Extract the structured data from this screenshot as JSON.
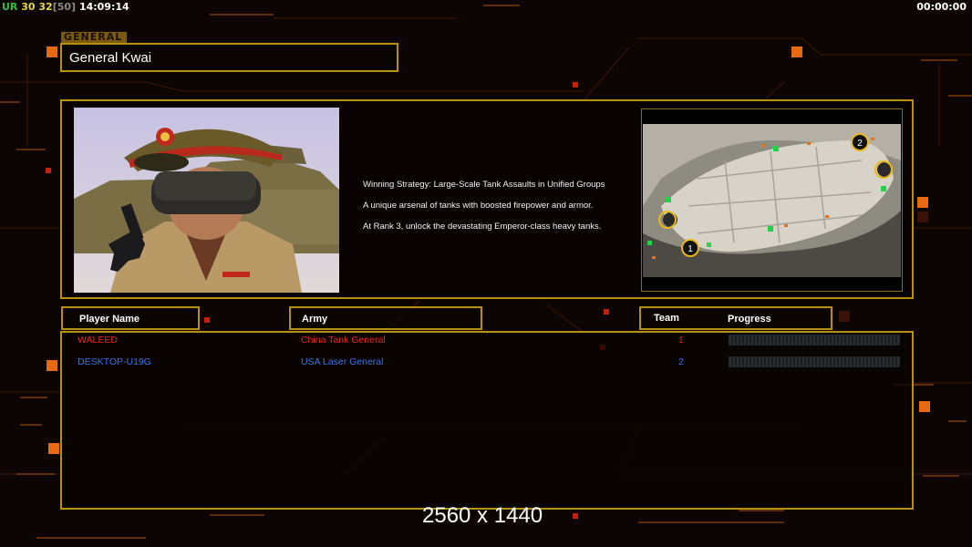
{
  "hud": {
    "ur_label": "UR",
    "ur_val1": "30",
    "ur_val2": "32",
    "ur_bracket": "[50]",
    "clock": "14:09:14",
    "timer": "00:00:00"
  },
  "section_label": "GENERAL",
  "general_name": "General Kwai",
  "strategy_lines": [
    "Winning Strategy: Large-Scale Tank Assaults in Unified Groups",
    "A unique arsenal of tanks with boosted firepower and armor.",
    "At Rank 3, unlock the devastating Emperor-class heavy tanks."
  ],
  "minimap": {
    "start_1": "1",
    "start_2": "2"
  },
  "table": {
    "col_player": "Player Name",
    "col_army": "Army",
    "col_team": "Team",
    "col_progress": "Progress",
    "players": [
      {
        "name": "WALEED",
        "army": "China Tank General",
        "team": "1",
        "color": "#e8271b",
        "progress": 0
      },
      {
        "name": "DESKTOP-U19G",
        "army": "USA Laser General",
        "team": "2",
        "color": "#3b74e8",
        "progress": 0
      }
    ]
  },
  "resolution_text": "2560 x 1440",
  "colors": {
    "accent_gold": "#b8900e",
    "hud_orange": "#e86a10",
    "background": "#0d0504"
  }
}
